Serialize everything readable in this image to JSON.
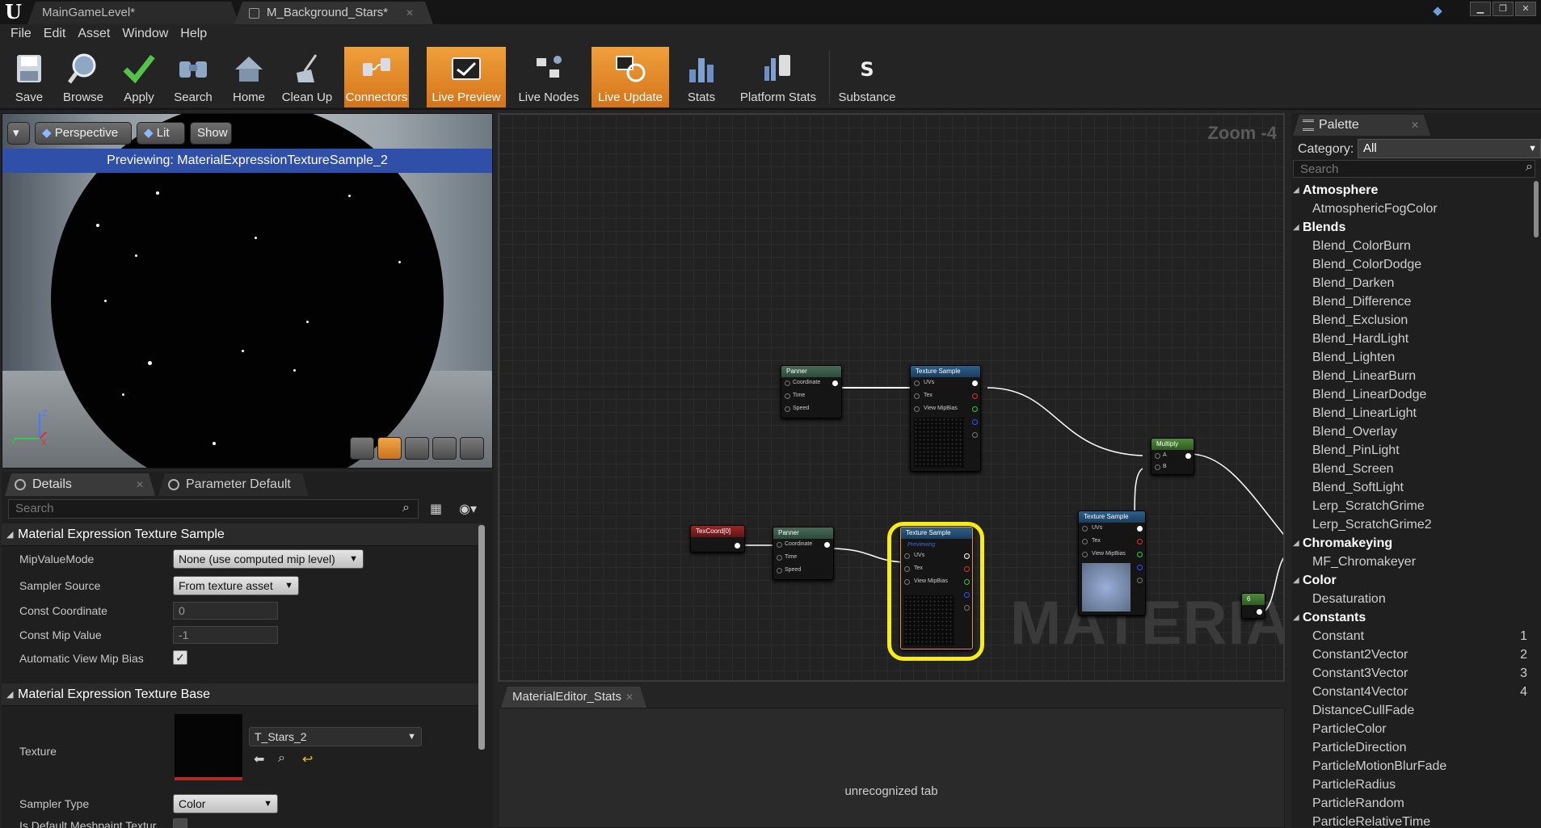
{
  "titlebar": {
    "tabs": [
      {
        "label": "MainGameLevel*"
      },
      {
        "label": "M_Background_Stars*"
      }
    ]
  },
  "menu": [
    "File",
    "Edit",
    "Asset",
    "Window",
    "Help"
  ],
  "toolbar": {
    "buttons": [
      {
        "label": "Save",
        "icon": "save-icon",
        "active": false
      },
      {
        "label": "Browse",
        "icon": "browse-icon",
        "active": false
      },
      {
        "label": "Apply",
        "icon": "apply-icon",
        "active": false
      },
      {
        "label": "Search",
        "icon": "search-icon",
        "active": false
      },
      {
        "label": "Home",
        "icon": "home-icon",
        "active": false
      },
      {
        "label": "Clean Up",
        "icon": "clean-up-icon",
        "active": false
      },
      {
        "label": "Connectors",
        "icon": "connectors-icon",
        "active": true
      },
      {
        "label": "Live Preview",
        "icon": "live-preview-icon",
        "active": true
      },
      {
        "label": "Live Nodes",
        "icon": "live-nodes-icon",
        "active": false
      },
      {
        "label": "Live Update",
        "icon": "live-update-icon",
        "active": true
      },
      {
        "label": "Stats",
        "icon": "stats-icon",
        "active": false
      },
      {
        "label": "Platform Stats",
        "icon": "platform-stats-icon",
        "active": false
      },
      {
        "label": "Substance",
        "icon": "substance-icon",
        "active": false
      }
    ]
  },
  "viewport": {
    "perspective": "Perspective",
    "lit": "Lit",
    "show": "Show",
    "previewing": "Previewing: MaterialExpressionTextureSample_2",
    "axis_z": "Z",
    "axis_x": "X",
    "axis_y": "Y"
  },
  "details": {
    "tabs": [
      {
        "label": "Details"
      },
      {
        "label": "Parameter Default"
      }
    ],
    "search_placeholder": "Search",
    "section1": {
      "title": "Material Expression Texture Sample",
      "mip_value_mode": {
        "label": "MipValueMode",
        "value": "None (use computed mip level)"
      },
      "sampler_source": {
        "label": "Sampler Source",
        "value": "From texture asset"
      },
      "const_coordinate": {
        "label": "Const Coordinate",
        "value": "0"
      },
      "const_mip_value": {
        "label": "Const Mip Value",
        "value": "-1"
      },
      "auto_view_mip_bias": {
        "label": "Automatic View Mip Bias",
        "checked": true
      }
    },
    "section2": {
      "title": "Material Expression Texture Base",
      "texture": {
        "label": "Texture",
        "value": "T_Stars_2"
      },
      "sampler_type": {
        "label": "Sampler Type",
        "value": "Color"
      },
      "default_meshpaint": {
        "label": "Is Default Meshpaint Textur",
        "checked": false
      }
    }
  },
  "graph": {
    "zoom": "Zoom -4",
    "watermark": "MATERIAL",
    "nodes": {
      "panner1": {
        "title": "Panner",
        "pins": [
          "Coordinate",
          "Time",
          "Speed"
        ]
      },
      "texsample1": {
        "title": "Texture Sample",
        "pins": [
          "UVs",
          "Tex",
          "View MipBias"
        ]
      },
      "texcoord": {
        "title": "TexCoord[0]"
      },
      "panner2": {
        "title": "Panner",
        "pins": [
          "Coordinate",
          "Time",
          "Speed"
        ]
      },
      "texsample2": {
        "title": "Texture Sample",
        "subtitle": "Previewing",
        "pins": [
          "UVs",
          "Tex",
          "View MipBias"
        ]
      },
      "texsample3": {
        "title": "Texture Sample",
        "pins": [
          "UVs",
          "Tex",
          "View MipBias"
        ]
      },
      "multiply": {
        "title": "Multiply",
        "pins": [
          "A",
          "B"
        ]
      },
      "constant": {
        "title": "6"
      }
    }
  },
  "stats": {
    "tab": "MaterialEditor_Stats",
    "message": "unrecognized tab"
  },
  "palette": {
    "tab": "Palette",
    "category_label": "Category:",
    "category_value": "All",
    "search_placeholder": "Search",
    "rows": [
      {
        "type": "cat",
        "label": "Atmosphere"
      },
      {
        "type": "item",
        "label": "AtmosphericFogColor"
      },
      {
        "type": "cat",
        "label": "Blends"
      },
      {
        "type": "item",
        "label": "Blend_ColorBurn"
      },
      {
        "type": "item",
        "label": "Blend_ColorDodge"
      },
      {
        "type": "item",
        "label": "Blend_Darken"
      },
      {
        "type": "item",
        "label": "Blend_Difference"
      },
      {
        "type": "item",
        "label": "Blend_Exclusion"
      },
      {
        "type": "item",
        "label": "Blend_HardLight"
      },
      {
        "type": "item",
        "label": "Blend_Lighten"
      },
      {
        "type": "item",
        "label": "Blend_LinearBurn"
      },
      {
        "type": "item",
        "label": "Blend_LinearDodge"
      },
      {
        "type": "item",
        "label": "Blend_LinearLight"
      },
      {
        "type": "item",
        "label": "Blend_Overlay"
      },
      {
        "type": "item",
        "label": "Blend_PinLight"
      },
      {
        "type": "item",
        "label": "Blend_Screen"
      },
      {
        "type": "item",
        "label": "Blend_SoftLight"
      },
      {
        "type": "item",
        "label": "Lerp_ScratchGrime"
      },
      {
        "type": "item",
        "label": "Lerp_ScratchGrime2"
      },
      {
        "type": "cat",
        "label": "Chromakeying"
      },
      {
        "type": "item",
        "label": "MF_Chromakeyer"
      },
      {
        "type": "cat",
        "label": "Color"
      },
      {
        "type": "item",
        "label": "Desaturation"
      },
      {
        "type": "cat",
        "label": "Constants"
      },
      {
        "type": "item",
        "label": "Constant",
        "key": "1"
      },
      {
        "type": "item",
        "label": "Constant2Vector",
        "key": "2"
      },
      {
        "type": "item",
        "label": "Constant3Vector",
        "key": "3"
      },
      {
        "type": "item",
        "label": "Constant4Vector",
        "key": "4"
      },
      {
        "type": "item",
        "label": "DistanceCullFade"
      },
      {
        "type": "item",
        "label": "ParticleColor"
      },
      {
        "type": "item",
        "label": "ParticleDirection"
      },
      {
        "type": "item",
        "label": "ParticleMotionBlurFade"
      },
      {
        "type": "item",
        "label": "ParticleRadius"
      },
      {
        "type": "item",
        "label": "ParticleRandom"
      },
      {
        "type": "item",
        "label": "ParticleRelativeTime"
      }
    ]
  },
  "colors": {
    "accent_orange": "#e8902c",
    "selection_yellow": "#f8ec18",
    "preview_banner": "#2f4fa8"
  }
}
